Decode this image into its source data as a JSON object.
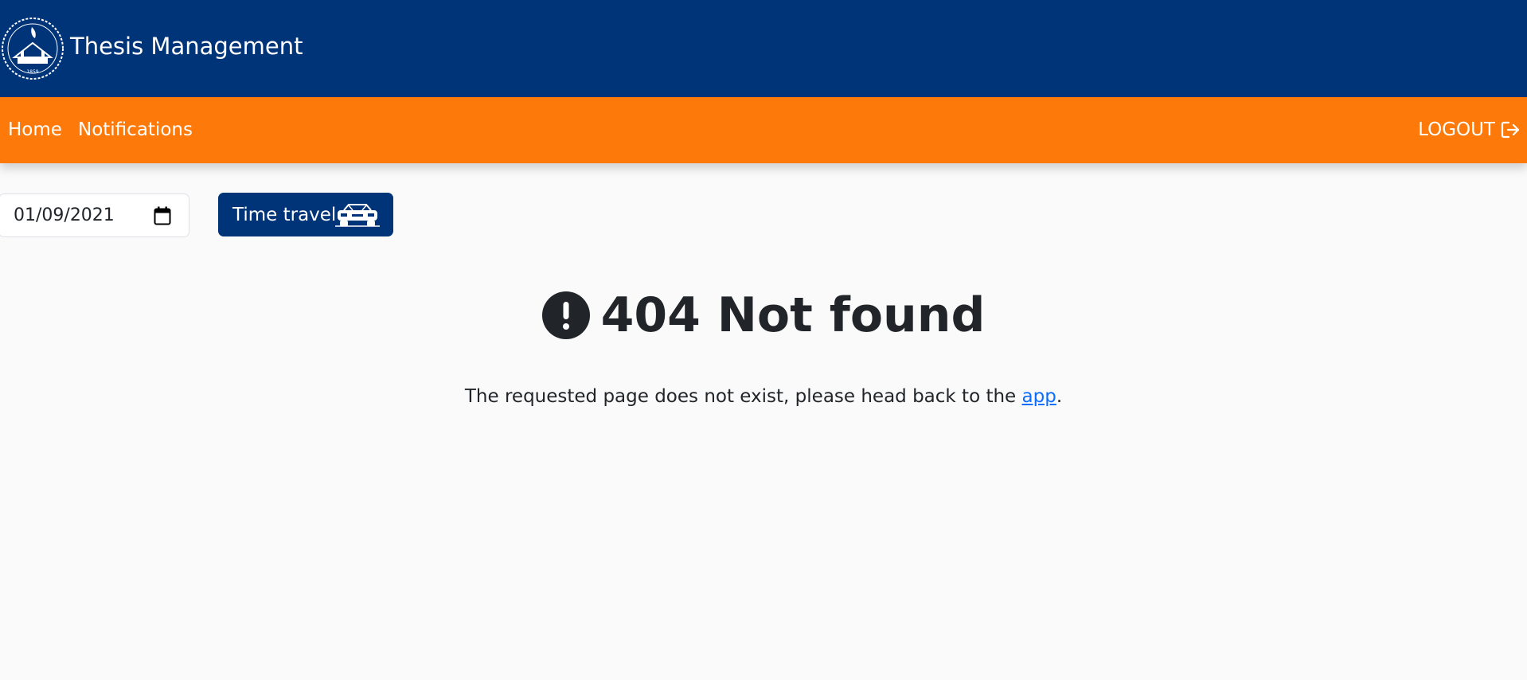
{
  "header": {
    "app_title": "Thesis Management",
    "logo_icon": "university-seal-icon",
    "logo_year": "1859"
  },
  "nav": {
    "home_label": "Home",
    "notifications_label": "Notifications",
    "logout_label": "LOGOUT",
    "logout_icon": "logout-arrow-icon"
  },
  "controls": {
    "date_value": "01/09/2021",
    "date_icon": "calendar-icon",
    "time_travel_label": "Time travel",
    "time_travel_icon": "car-icon"
  },
  "error": {
    "icon": "exclamation-circle-icon",
    "title": "404 Not found",
    "message_prefix": "The requested page does not exist, please head back to the ",
    "link_label": "app",
    "message_suffix": "."
  },
  "colors": {
    "header_bg": "#003479",
    "nav_bg": "#fd7a0a",
    "page_bg": "#fafafa",
    "link": "#0d6efd"
  }
}
